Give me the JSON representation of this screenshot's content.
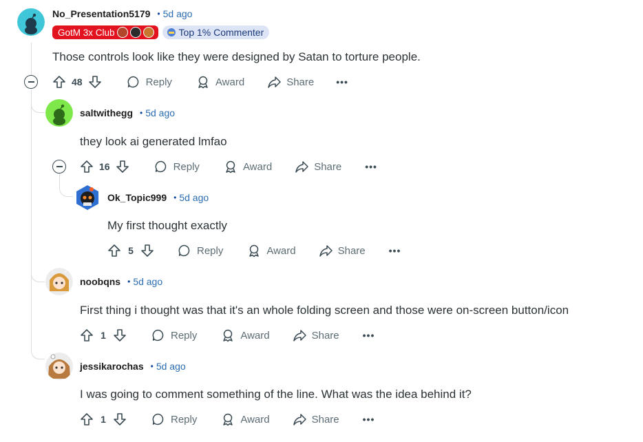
{
  "comments": [
    {
      "author": "No_Presentation5179",
      "time": "5d ago",
      "dot": "•",
      "flairs": {
        "club": "GotM 3x Club",
        "commenter": "Top 1% Commenter"
      },
      "body": "Those controls look like they were designed by Satan to torture people.",
      "votes": "48",
      "reply": "Reply",
      "award": "Award",
      "share": "Share",
      "more": "•••"
    },
    {
      "author": "saltwithegg",
      "time": "5d ago",
      "dot": "•",
      "body": "they look ai generated lmfao",
      "votes": "16",
      "reply": "Reply",
      "award": "Award",
      "share": "Share",
      "more": "•••"
    },
    {
      "author": "Ok_Topic999",
      "time": "5d ago",
      "dot": "•",
      "body": "My first thought exactly",
      "votes": "5",
      "reply": "Reply",
      "award": "Award",
      "share": "Share",
      "more": "•••"
    },
    {
      "author": "noobqns",
      "time": "5d ago",
      "dot": "•",
      "body": "First thing i thought was that it's an whole folding screen and those were on-screen button/icon",
      "votes": "1",
      "reply": "Reply",
      "award": "Award",
      "share": "Share",
      "more": "•••"
    },
    {
      "author": "jessikarochas",
      "time": "5d ago",
      "dot": "•",
      "body": "I was going to comment something of the line. What was the idea behind it?",
      "votes": "1",
      "reply": "Reply",
      "award": "Award",
      "share": "Share",
      "more": "•••"
    }
  ],
  "colors": {
    "accent_time": "#2a6db3",
    "flair_red": "#e3121f",
    "flair_blue": "#dde4f6",
    "thread_line": "#d9dde0"
  },
  "icons": [
    "upvote-icon",
    "downvote-icon",
    "comment-icon",
    "award-icon",
    "share-icon",
    "collapse-icon"
  ]
}
